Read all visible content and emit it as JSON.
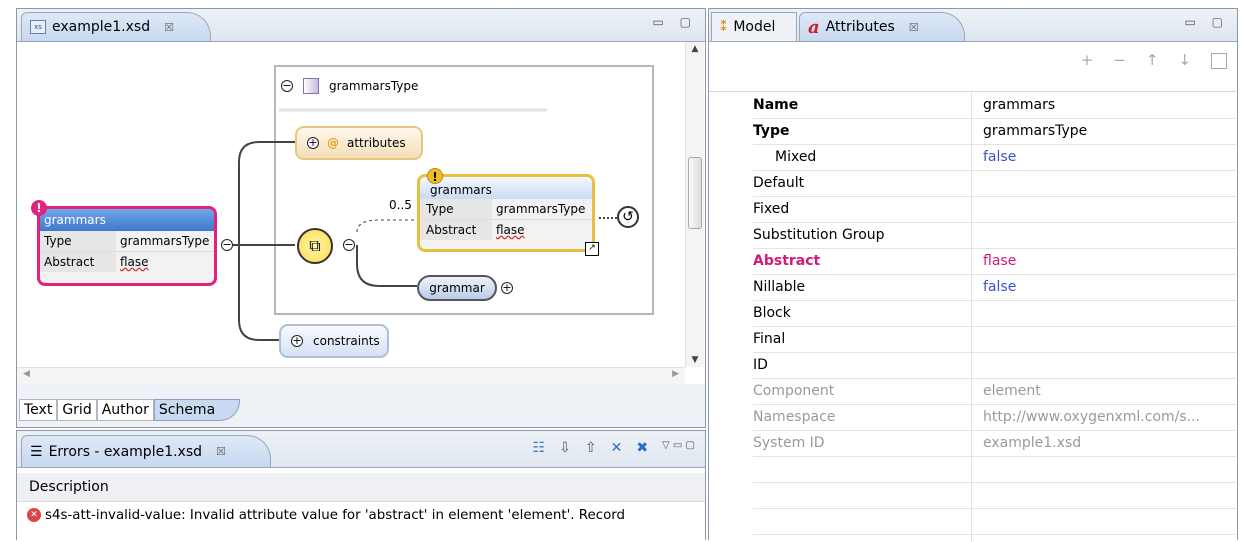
{
  "editor": {
    "tab_title": "example1.xsd",
    "close_symbol": "☒",
    "window_controls": "▭ ▢",
    "bottom_tabs": [
      "Text",
      "Grid",
      "Author",
      "Schema"
    ],
    "diagram": {
      "root_type_label": "grammarsType",
      "main_element": {
        "title": "grammars",
        "rows": [
          {
            "k": "Type",
            "v": "grammarsType"
          },
          {
            "k": "Abstract",
            "v": "flase"
          }
        ]
      },
      "attributes_label": "attributes",
      "cardinality": "0..5",
      "child_element": {
        "title": "grammars",
        "rows": [
          {
            "k": "Type",
            "v": "grammarsType"
          },
          {
            "k": "Abstract",
            "v": "flase"
          }
        ]
      },
      "grammar_label": "grammar",
      "constraints_label": "constraints"
    }
  },
  "errors_panel": {
    "tab_title": "Errors - example1.xsd",
    "column_header": "Description",
    "message": "s4s-att-invalid-value: Invalid attribute value for 'abstract' in element 'element'. Record"
  },
  "attributes_panel": {
    "tab_model": "Model",
    "tab_attributes": "Attributes",
    "toolbar": [
      "+",
      "−",
      "↑",
      "↓"
    ],
    "properties": [
      {
        "name": "Name",
        "value": "grammars",
        "style": "bold"
      },
      {
        "name": "Type",
        "value": "grammarsType",
        "style": "bold"
      },
      {
        "name": "Mixed",
        "value": "false",
        "style": "indent-blue"
      },
      {
        "name": "Default",
        "value": "",
        "style": "normal"
      },
      {
        "name": "Fixed",
        "value": "",
        "style": "normal"
      },
      {
        "name": "Substitution Group",
        "value": "",
        "style": "normal"
      },
      {
        "name": "Abstract",
        "value": "flase",
        "style": "pink"
      },
      {
        "name": "Nillable",
        "value": "false",
        "style": "blue"
      },
      {
        "name": "Block",
        "value": "",
        "style": "normal"
      },
      {
        "name": "Final",
        "value": "",
        "style": "normal"
      },
      {
        "name": "ID",
        "value": "",
        "style": "normal"
      },
      {
        "name": "Component",
        "value": "element",
        "style": "dim"
      },
      {
        "name": "Namespace",
        "value": "http://www.oxygenxml.com/s...",
        "style": "dim"
      },
      {
        "name": "System ID",
        "value": "example1.xsd",
        "style": "dim"
      }
    ]
  }
}
